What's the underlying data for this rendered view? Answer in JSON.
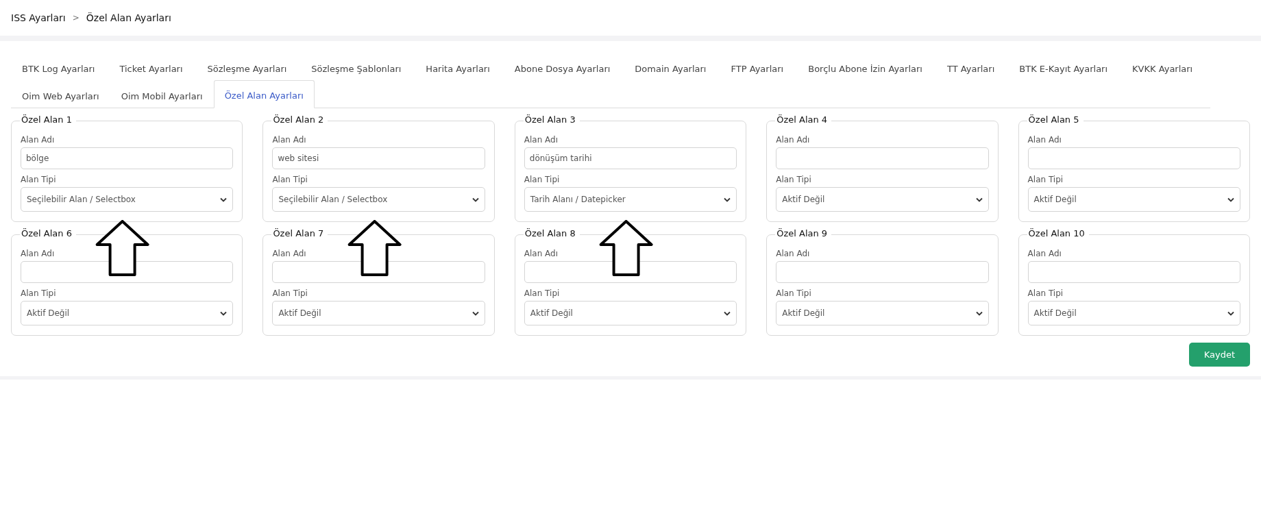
{
  "breadcrumb": {
    "items": [
      "ISS Ayarları",
      "Özel Alan Ayarları"
    ],
    "separator": ">"
  },
  "tabs": [
    {
      "label": "BTK Log Ayarları",
      "selected": false
    },
    {
      "label": "Ticket Ayarları",
      "selected": false
    },
    {
      "label": "Sözleşme Ayarları",
      "selected": false
    },
    {
      "label": "Sözleşme Şablonları",
      "selected": false
    },
    {
      "label": "Harita Ayarları",
      "selected": false
    },
    {
      "label": "Abone Dosya Ayarları",
      "selected": false
    },
    {
      "label": "Domain Ayarları",
      "selected": false
    },
    {
      "label": "FTP Ayarları",
      "selected": false
    },
    {
      "label": "Borçlu Abone İzin Ayarları",
      "selected": false
    },
    {
      "label": "TT Ayarları",
      "selected": false
    },
    {
      "label": "BTK E-Kayıt Ayarları",
      "selected": false
    },
    {
      "label": "KVKK Ayarları",
      "selected": false
    },
    {
      "label": "Oim Web Ayarları",
      "selected": false
    },
    {
      "label": "Oim Mobil Ayarları",
      "selected": false
    },
    {
      "label": "Özel Alan Ayarları",
      "selected": true
    }
  ],
  "fields": [
    {
      "title": "Özel Alan 1",
      "name_label": "Alan Adı",
      "name_value": "bölge",
      "type_label": "Alan Tipi",
      "type_value": "Seçilebilir Alan / Selectbox",
      "arrow": true
    },
    {
      "title": "Özel Alan 2",
      "name_label": "Alan Adı",
      "name_value": "web sitesi",
      "type_label": "Alan Tipi",
      "type_value": "Seçilebilir Alan / Selectbox",
      "arrow": true
    },
    {
      "title": "Özel Alan 3",
      "name_label": "Alan Adı",
      "name_value": "dönüşüm tarihi",
      "type_label": "Alan Tipi",
      "type_value": "Tarih Alanı / Datepicker",
      "arrow": true
    },
    {
      "title": "Özel Alan 4",
      "name_label": "Alan Adı",
      "type_label": "Alan Tipi",
      "type_value": "Aktif Değil",
      "arrow": false
    },
    {
      "title": "Özel Alan 5",
      "name_label": "Alan Adı",
      "type_label": "Alan Tipi",
      "type_value": "Aktif Değil",
      "arrow": false
    },
    {
      "title": "Özel Alan 6",
      "name_label": "Alan Adı",
      "type_label": "Alan Tipi",
      "type_value": "Aktif Değil",
      "arrow": false
    },
    {
      "title": "Özel Alan 7",
      "name_label": "Alan Adı",
      "type_label": "Alan Tipi",
      "type_value": "Aktif Değil",
      "arrow": false
    },
    {
      "title": "Özel Alan 8",
      "name_label": "Alan Adı",
      "type_label": "Alan Tipi",
      "type_value": "Aktif Değil",
      "arrow": false
    },
    {
      "title": "Özel Alan 9",
      "name_label": "Alan Adı",
      "type_label": "Alan Tipi",
      "type_value": "Aktif Değil",
      "arrow": false
    },
    {
      "title": "Özel Alan 10",
      "name_label": "Alan Adı",
      "type_label": "Alan Tipi",
      "type_value": "Aktif Değil",
      "arrow": false
    }
  ],
  "save_button": "Kaydet"
}
